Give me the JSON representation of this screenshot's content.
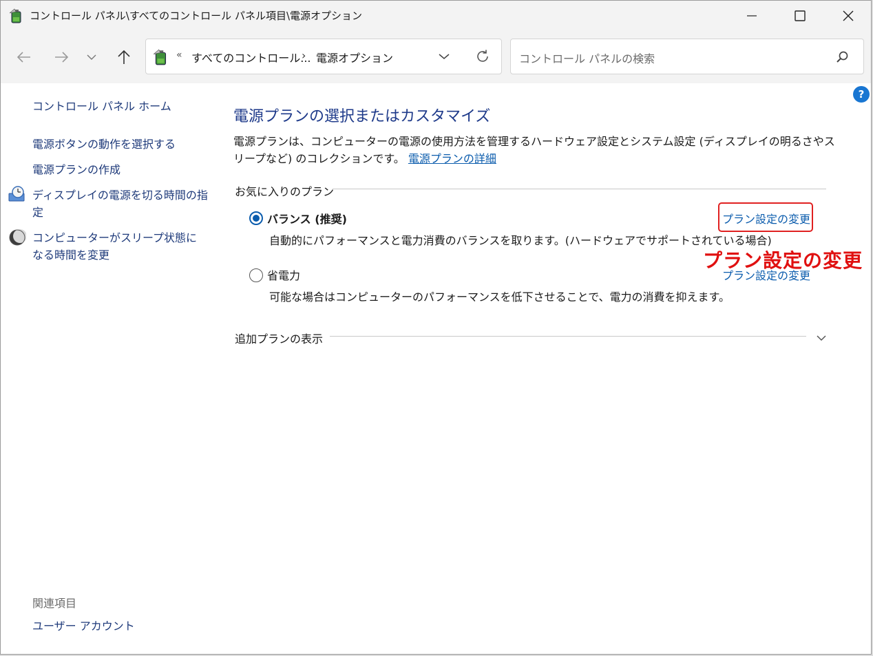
{
  "window": {
    "title": "コントロール パネル\\すべてのコントロール パネル項目\\電源オプション",
    "icon": "power-options-battery-icon"
  },
  "nav": {
    "back_icon": "arrow-left-icon",
    "forward_icon": "arrow-right-icon",
    "recent_icon": "chevron-down-icon",
    "up_icon": "arrow-up-icon"
  },
  "address": {
    "overflow": "«",
    "part1": "すべてのコントロール...",
    "separator": "›",
    "part2": "電源オプション"
  },
  "search": {
    "placeholder": "コントロール パネルの検索"
  },
  "sidebar": {
    "home": "コントロール パネル ホーム",
    "links": [
      {
        "label": "電源ボタンの動作を選択する"
      },
      {
        "label": "電源プランの作成"
      },
      {
        "label": "ディスプレイの電源を切る時間の指定",
        "icon": "display-clock-icon"
      },
      {
        "label": "コンピューターがスリープ状態になる時間を変更",
        "icon": "moon-sleep-icon"
      }
    ],
    "related_heading": "関連項目",
    "related_links": [
      {
        "label": "ユーザー アカウント"
      }
    ]
  },
  "main": {
    "title": "電源プランの選択またはカスタマイズ",
    "description": "電源プランは、コンピューターの電源の使用方法を管理するハードウェア設定とシステム設定 (ディスプレイの明るさやスリープなど) のコレクションです。",
    "details_link": "電源プランの詳細",
    "favorites_label": "お気に入りのプラン",
    "plans": [
      {
        "name": "バランス (推奨)",
        "selected": true,
        "description": "自動的にパフォーマンスと電力消費のバランスを取ります。(ハードウェアでサポートされている場合)",
        "link": "プラン設定の変更"
      },
      {
        "name": "省電力",
        "selected": false,
        "description": "可能な場合はコンピューターのパフォーマンスを低下させることで、電力の消費を抑えます。",
        "link": "プラン設定の変更"
      }
    ],
    "additional_plans_label": "追加プランの表示"
  },
  "annotation": {
    "text": "プラン設定の変更",
    "color": "#e01010"
  },
  "colors": {
    "link": "#0b5cad",
    "title": "#1e3a8a",
    "accent": "#1976d2"
  }
}
